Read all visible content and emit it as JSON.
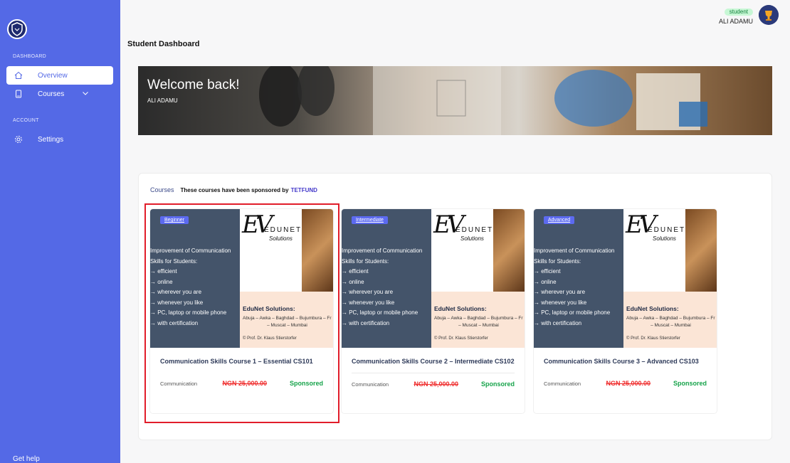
{
  "sidebar": {
    "section_dashboard": "DASHBOARD",
    "section_account": "ACCOUNT",
    "items": [
      {
        "label": "Overview"
      },
      {
        "label": "Courses"
      },
      {
        "label": "Settings"
      }
    ],
    "get_help": "Get help"
  },
  "user": {
    "role": "student",
    "name": "ALI ADAMU"
  },
  "page": {
    "title": "Student Dashboard"
  },
  "banner": {
    "welcome": "Welcome back!",
    "name": "ALI ADAMU"
  },
  "courses_panel": {
    "title": "Courses",
    "sponsor_text": "These courses have been sponsored by",
    "sponsor_name": "TETFUND"
  },
  "thumbnail": {
    "lines": [
      "Improvement of Communication",
      "Skills for Students:",
      "→ efficient",
      "→ online",
      "→ wherever you are",
      "→ whenever you like",
      "→ PC, laptop or mobile phone",
      "→ with certification"
    ],
    "edunet_title": "EduNet Solutions:",
    "cities_1": "Abuja – Awka – Baghdad – Bujumbura – Fr",
    "cities_2": "– Muscat – Mumbai",
    "prof": "© Prof. Dr. Klaus Stierstorfer",
    "logo_word": "EDUNET",
    "logo_sub": "Solutions"
  },
  "courses": [
    {
      "level": "Beginner",
      "name": "Communication Skills Course 1 – Essential CS101",
      "category": "Communication",
      "price": "NGN 25,000.00",
      "status": "Sponsored"
    },
    {
      "level": "Intermediate",
      "name": "Communication Skills Course 2 – Intermediate CS102",
      "category": "Communication",
      "price": "NGN 25,000.00",
      "status": "Sponsored"
    },
    {
      "level": "Advanced",
      "name": "Communication Skills Course 3 – Advanced CS103",
      "category": "Communication",
      "price": "NGN 25,000.00",
      "status": "Sponsored"
    }
  ],
  "colors": {
    "sidebar": "#5469e6",
    "badge": "#5c6af0",
    "price_strike": "#ef2b2b",
    "sponsored": "#16a34a",
    "highlight": "#e11d2a"
  }
}
